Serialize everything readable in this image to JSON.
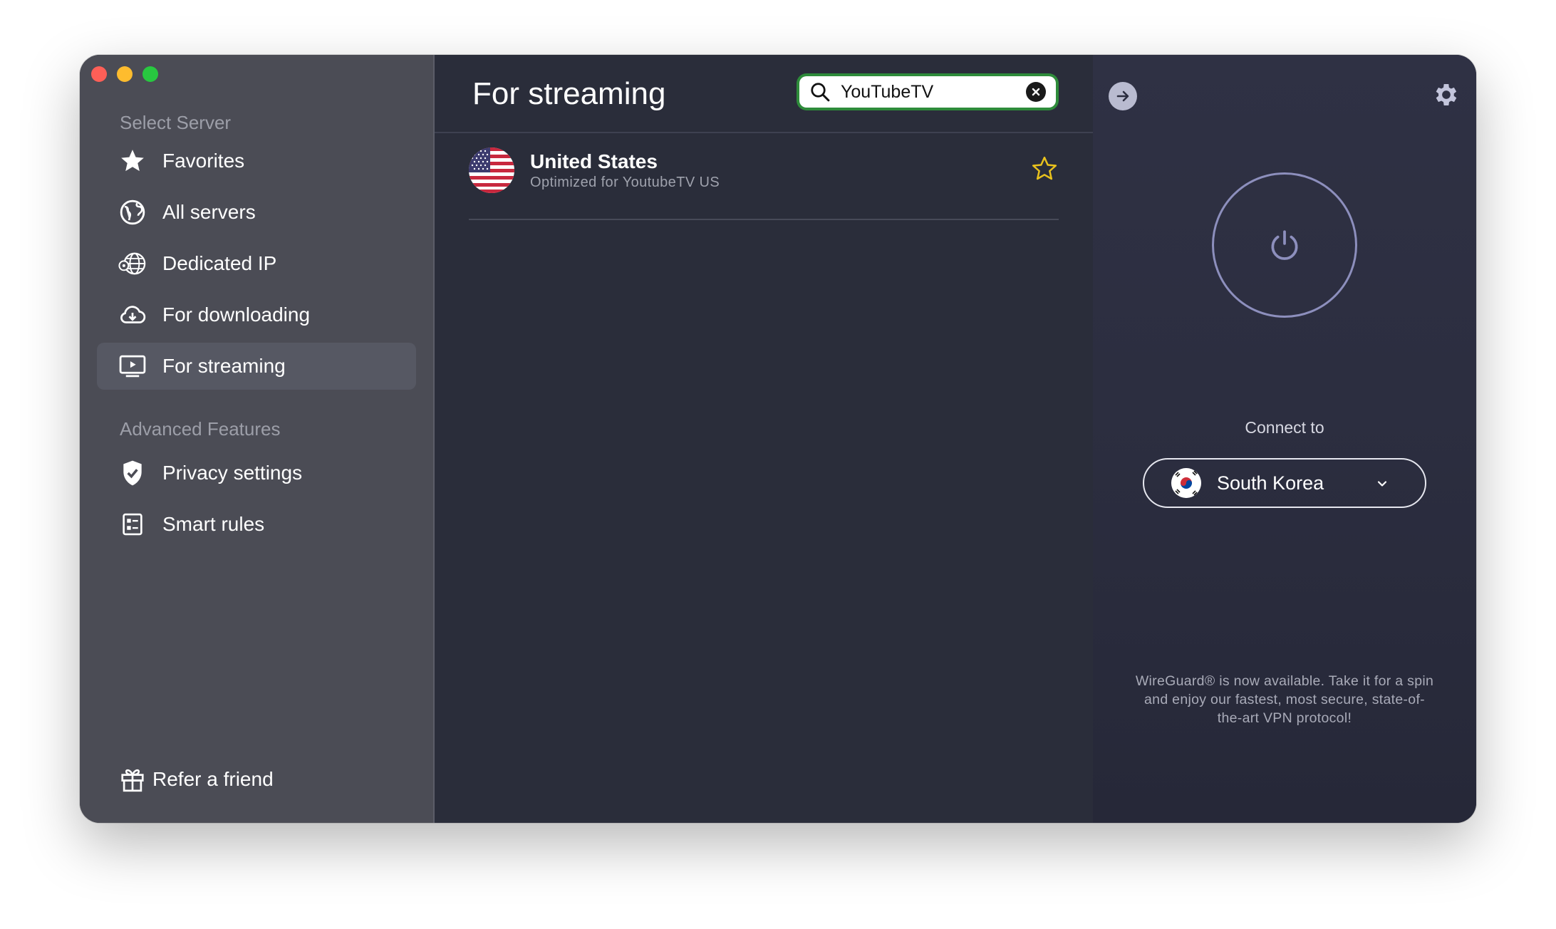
{
  "sidebar": {
    "select_server_label": "Select Server",
    "items": [
      {
        "label": "Favorites",
        "icon": "star-icon"
      },
      {
        "label": "All servers",
        "icon": "globe-icon"
      },
      {
        "label": "Dedicated IP",
        "icon": "globe-ip-icon"
      },
      {
        "label": "For downloading",
        "icon": "cloud-download-icon"
      },
      {
        "label": "For streaming",
        "icon": "tv-play-icon",
        "active": true
      }
    ],
    "advanced_label": "Advanced Features",
    "advanced_items": [
      {
        "label": "Privacy settings",
        "icon": "shield-check-icon"
      },
      {
        "label": "Smart rules",
        "icon": "rules-list-icon"
      }
    ],
    "refer_label": "Refer a friend"
  },
  "main": {
    "title": "For streaming",
    "search": {
      "value": "YouTubeTV"
    },
    "results": [
      {
        "name": "United States",
        "description": "Optimized for YoutubeTV US",
        "favorite": false
      }
    ]
  },
  "connect_panel": {
    "connect_label": "Connect to",
    "country": "South Korea",
    "wireguard_notice": "WireGuard® is now available. Take it for a spin and enjoy our fastest, most secure, state-of-the-art VPN protocol!"
  },
  "colors": {
    "sidebar_bg": "#4b4c55",
    "main_bg": "#2a2d3a",
    "search_focus": "#2e8b3a",
    "star_outline": "#e9c21d",
    "power_ring": "#8d8fbd"
  }
}
